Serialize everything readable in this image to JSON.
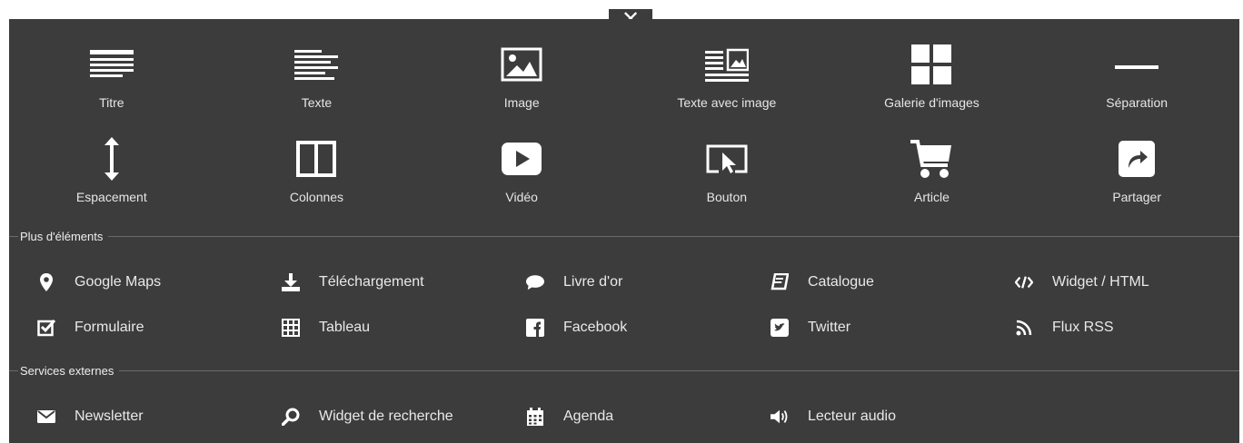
{
  "close_symbol": "✕",
  "main_items": [
    {
      "label": "Titre",
      "icon": "title-icon"
    },
    {
      "label": "Texte",
      "icon": "text-icon"
    },
    {
      "label": "Image",
      "icon": "image-icon"
    },
    {
      "label": "Texte avec image",
      "icon": "text-with-image-icon"
    },
    {
      "label": "Galerie d'images",
      "icon": "gallery-icon"
    },
    {
      "label": "Séparation",
      "icon": "separator-icon"
    },
    {
      "label": "Espacement",
      "icon": "spacing-icon"
    },
    {
      "label": "Colonnes",
      "icon": "columns-icon"
    },
    {
      "label": "Vidéo",
      "icon": "video-icon"
    },
    {
      "label": "Bouton",
      "icon": "button-icon"
    },
    {
      "label": "Article",
      "icon": "cart-icon"
    },
    {
      "label": "Partager",
      "icon": "share-icon"
    }
  ],
  "more_elements": {
    "title": "Plus d'éléments",
    "items": [
      {
        "label": "Google Maps",
        "icon": "map-marker-icon"
      },
      {
        "label": "Téléchargement",
        "icon": "download-icon"
      },
      {
        "label": "Livre d'or",
        "icon": "comment-icon"
      },
      {
        "label": "Catalogue",
        "icon": "catalog-icon"
      },
      {
        "label": "Widget / HTML",
        "icon": "code-icon"
      },
      {
        "label": "Formulaire",
        "icon": "form-checkbox-icon"
      },
      {
        "label": "Tableau",
        "icon": "table-icon"
      },
      {
        "label": "Facebook",
        "icon": "facebook-icon"
      },
      {
        "label": "Twitter",
        "icon": "twitter-icon"
      },
      {
        "label": "Flux RSS",
        "icon": "rss-icon"
      }
    ]
  },
  "external_services": {
    "title": "Services externes",
    "items": [
      {
        "label": "Newsletter",
        "icon": "envelope-icon"
      },
      {
        "label": "Widget de recherche",
        "icon": "search-icon"
      },
      {
        "label": "Agenda",
        "icon": "calendar-icon"
      },
      {
        "label": "Lecteur audio",
        "icon": "volume-icon"
      }
    ]
  }
}
